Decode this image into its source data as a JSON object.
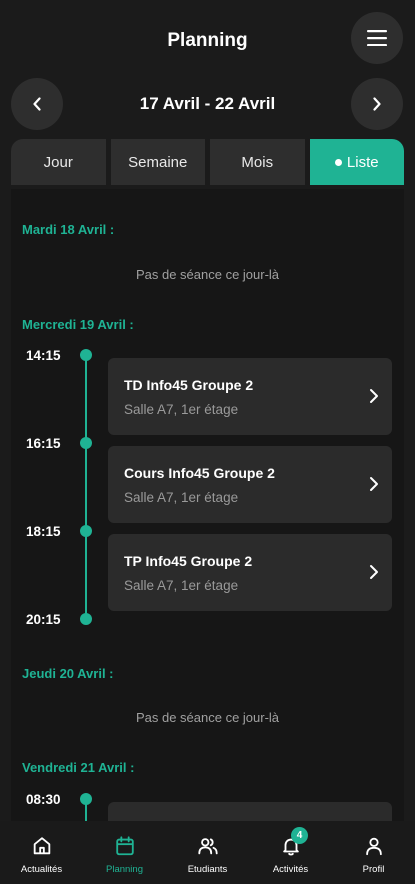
{
  "header": {
    "title": "Planning",
    "date_range": "17 Avril - 22 Avril"
  },
  "tabs": [
    {
      "label": "Jour",
      "active": false
    },
    {
      "label": "Semaine",
      "active": false
    },
    {
      "label": "Mois",
      "active": false
    },
    {
      "label": "Liste",
      "active": true
    }
  ],
  "schedule": {
    "days": [
      {
        "label": "Mardi 18 Avril :",
        "empty_text": "Pas de séance ce jour-là"
      },
      {
        "label": "Mercredi 19 Avril :"
      },
      {
        "label": "Jeudi 20 Avril :",
        "empty_text": "Pas de séance ce jour-là"
      },
      {
        "label": "Vendredi 21 Avril :"
      }
    ],
    "wednesday_times": [
      "14:15",
      "16:15",
      "18:15",
      "20:15"
    ],
    "friday_times": [
      "08:30"
    ],
    "sessions": [
      {
        "title": "TD Info45 Groupe 2",
        "location": "Salle A7, 1er étage"
      },
      {
        "title": "Cours Info45 Groupe 2",
        "location": "Salle A7, 1er étage"
      },
      {
        "title": "TP Info45 Groupe 2",
        "location": "Salle A7, 1er étage"
      }
    ]
  },
  "nav": {
    "items": [
      {
        "label": "Actualités",
        "icon": "home-icon"
      },
      {
        "label": "Planning",
        "icon": "calendar-icon",
        "active": true
      },
      {
        "label": "Etudiants",
        "icon": "users-icon"
      },
      {
        "label": "Activités",
        "icon": "bell-icon",
        "badge": "4"
      },
      {
        "label": "Profil",
        "icon": "user-icon"
      }
    ]
  },
  "colors": {
    "accent": "#1fb394",
    "background": "#1b1b1b",
    "surface": "#2e2e2e"
  }
}
